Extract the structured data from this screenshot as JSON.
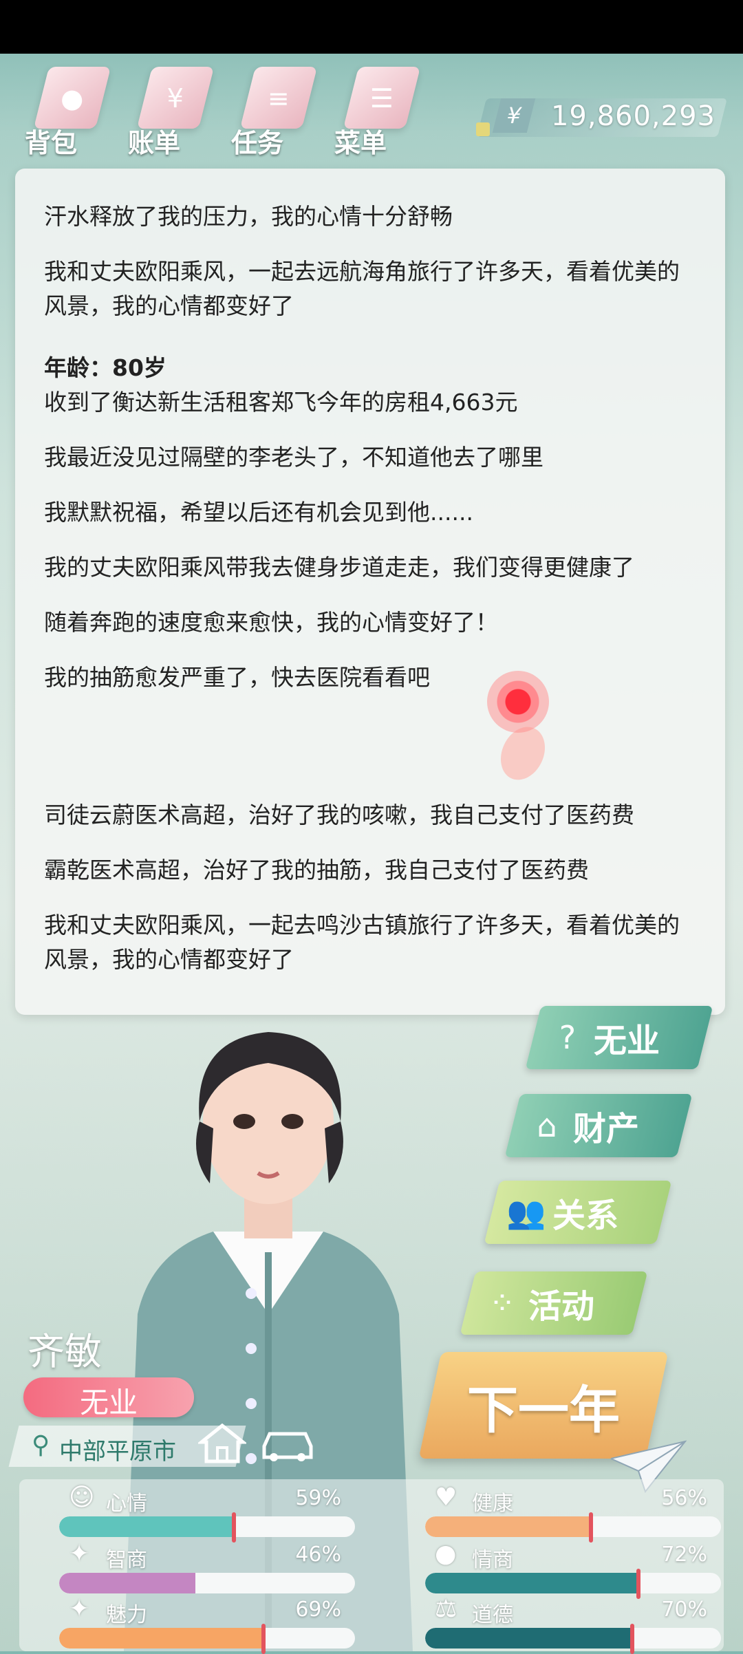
{
  "nav": [
    {
      "label": "背包",
      "icon": "backpack-icon",
      "glyph": "●"
    },
    {
      "label": "账单",
      "icon": "bill-icon",
      "glyph": "¥"
    },
    {
      "label": "任务",
      "icon": "task-icon",
      "glyph": "≡"
    },
    {
      "label": "菜单",
      "icon": "menu-icon",
      "glyph": "☰"
    }
  ],
  "money": {
    "symbol": "¥",
    "value": "19,860,293"
  },
  "log": [
    "汗水释放了我的压力，我的心情十分舒畅",
    "我和丈夫欧阳乘风，一起去远航海角旅行了许多天，看着优美的风景，我的心情都变好了",
    "年龄：80岁",
    "收到了衡达新生活租客郑飞今年的房租4,663元",
    "我最近没见过隔壁的李老头了，不知道他去了哪里",
    "我默默祝福，希望以后还有机会见到他......",
    "我的丈夫欧阳乘风带我去健身步道走走，我们变得更健康了",
    "随着奔跑的速度愈来愈快，我的心情变好了！",
    "我的抽筋愈发严重了，快去医院看看吧",
    "",
    "司徒云蔚医术高超，治好了我的咳嗽，我自己支付了医药费",
    "霸乾医术高超，治好了我的抽筋，我自己支付了医药费",
    "我和丈夫欧阳乘风，一起去鸣沙古镇旅行了许多天，看着优美的风景，我的心情都变好了"
  ],
  "actions": [
    {
      "label": "无业",
      "icon": "question-icon",
      "glyph": "?"
    },
    {
      "label": "财产",
      "icon": "house-icon",
      "glyph": "⌂"
    },
    {
      "label": "关系",
      "icon": "people-icon",
      "glyph": "👥"
    },
    {
      "label": "活动",
      "icon": "activity-icon",
      "glyph": "⁘"
    }
  ],
  "next_year": "下一年",
  "character": {
    "name": "齐敏",
    "job": "无业",
    "location": "中部平原市"
  },
  "stats": [
    {
      "name": "心情",
      "value": "59%",
      "pct": 59,
      "icon": "smile-icon",
      "glyph": "☺",
      "color": "#5fc4bc"
    },
    {
      "name": "健康",
      "value": "56%",
      "pct": 56,
      "icon": "heart-icon",
      "glyph": "♥",
      "color": "#f5b07a"
    },
    {
      "name": "智商",
      "value": "46%",
      "pct": 46,
      "icon": "brain-icon",
      "glyph": "✦",
      "color": "#c486c2"
    },
    {
      "name": "情商",
      "value": "72%",
      "pct": 72,
      "icon": "apple-icon",
      "glyph": "●",
      "color": "#2e8a8c"
    },
    {
      "name": "魅力",
      "value": "69%",
      "pct": 69,
      "icon": "sparkle-icon",
      "glyph": "✦",
      "color": "#f7a564"
    },
    {
      "name": "道德",
      "value": "70%",
      "pct": 70,
      "icon": "scale-icon",
      "glyph": "⚖",
      "color": "#1f6c73"
    }
  ]
}
